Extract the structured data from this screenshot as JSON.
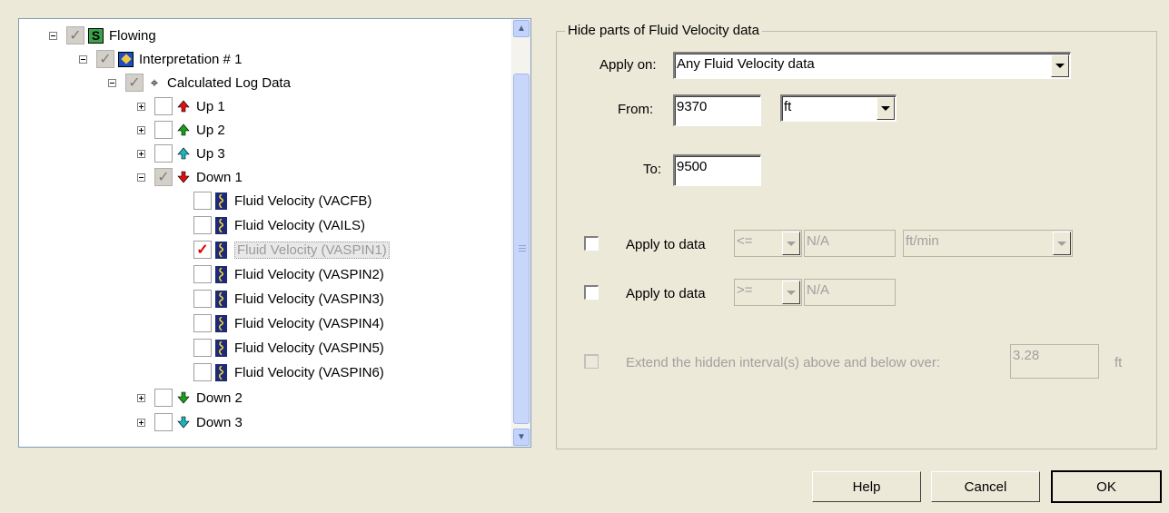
{
  "tree": {
    "root": {
      "label": "Flowing",
      "icon": "s-icon"
    },
    "interpretation": {
      "label": "Interpretation # 1",
      "icon": "interpretation-icon"
    },
    "calculated": {
      "label": "Calculated Log Data",
      "icon": "log-data-icon"
    },
    "items": [
      {
        "label": "Up 1",
        "color": "#e01010",
        "dir": "up"
      },
      {
        "label": "Up 2",
        "color": "#1aa01a",
        "dir": "up"
      },
      {
        "label": "Up 3",
        "color": "#18b8c0",
        "dir": "up"
      },
      {
        "label": "Down 1",
        "color": "#e01010",
        "dir": "down"
      }
    ],
    "leaves": [
      {
        "label": "Fluid Velocity (VACFB)",
        "checked": false
      },
      {
        "label": "Fluid Velocity (VAILS)",
        "checked": false
      },
      {
        "label": "Fluid Velocity (VASPIN1)",
        "checked": true
      },
      {
        "label": "Fluid Velocity (VASPIN2)",
        "checked": false
      },
      {
        "label": "Fluid Velocity (VASPIN3)",
        "checked": false
      },
      {
        "label": "Fluid Velocity (VASPIN4)",
        "checked": false
      },
      {
        "label": "Fluid Velocity (VASPIN5)",
        "checked": false
      },
      {
        "label": "Fluid Velocity (VASPIN6)",
        "checked": false
      }
    ],
    "tail": [
      {
        "label": "Down 2",
        "color": "#1aa01a",
        "dir": "down"
      },
      {
        "label": "Down 3",
        "color": "#18b8c0",
        "dir": "down"
      }
    ]
  },
  "panel": {
    "title": "Hide parts of Fluid Velocity data",
    "apply_on_label": "Apply on:",
    "apply_on_value": "Any Fluid Velocity data",
    "from_label": "From:",
    "from_value": "9370",
    "from_unit": "ft",
    "to_label": "To:",
    "to_value": "9500",
    "apply1_label": "Apply to data",
    "apply1_op": "<=",
    "apply1_value": "N/A",
    "apply1_unit": "ft/min",
    "apply2_label": "Apply to data",
    "apply2_op": ">=",
    "apply2_value": "N/A",
    "extend_label": "Extend the hidden interval(s) above and below over:",
    "extend_value": "3.28",
    "extend_unit": "ft"
  },
  "buttons": {
    "help": "Help",
    "cancel": "Cancel",
    "ok": "OK"
  }
}
